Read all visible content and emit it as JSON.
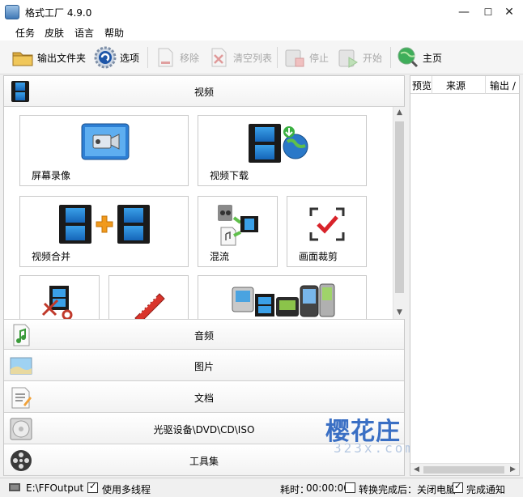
{
  "window": {
    "title": "格式工厂 4.9.0",
    "min": "—",
    "max": "☐",
    "close": "✕"
  },
  "menu": [
    "任务",
    "皮肤",
    "语言",
    "帮助"
  ],
  "toolbar": {
    "output_folder": "输出文件夹",
    "options": "选项",
    "remove": "移除",
    "clear_list": "清空列表",
    "stop": "停止",
    "start": "开始",
    "home": "主页"
  },
  "categories": {
    "video": "视频",
    "audio": "音频",
    "image": "图片",
    "document": "文档",
    "disc": "光驱设备\\DVD\\CD\\ISO",
    "tools": "工具集"
  },
  "video_tiles": {
    "screen_record": "屏幕录像",
    "video_download": "视频下载",
    "video_join": "视频合并",
    "mux": "混流",
    "crop": "画面裁剪"
  },
  "task_list": {
    "col_preview": "预览",
    "col_source": "来源",
    "col_output": "输出 /"
  },
  "status": {
    "output_path": "E:\\FFOutput",
    "multithread": "使用多线程",
    "multithread_checked": true,
    "elapsed_label": "耗时：",
    "elapsed": "00:00:00",
    "after_convert": "转换完成后：关闭电脑",
    "after_convert_checked": false,
    "notify": "完成通知",
    "notify_checked": true
  },
  "watermark": {
    "text": "樱花庄",
    "sub": "323x.com"
  },
  "colors": {
    "accent_blue": "#2f6fc0",
    "disabled_text": "#a8a8a8",
    "panel_border": "#c8c8c8"
  }
}
